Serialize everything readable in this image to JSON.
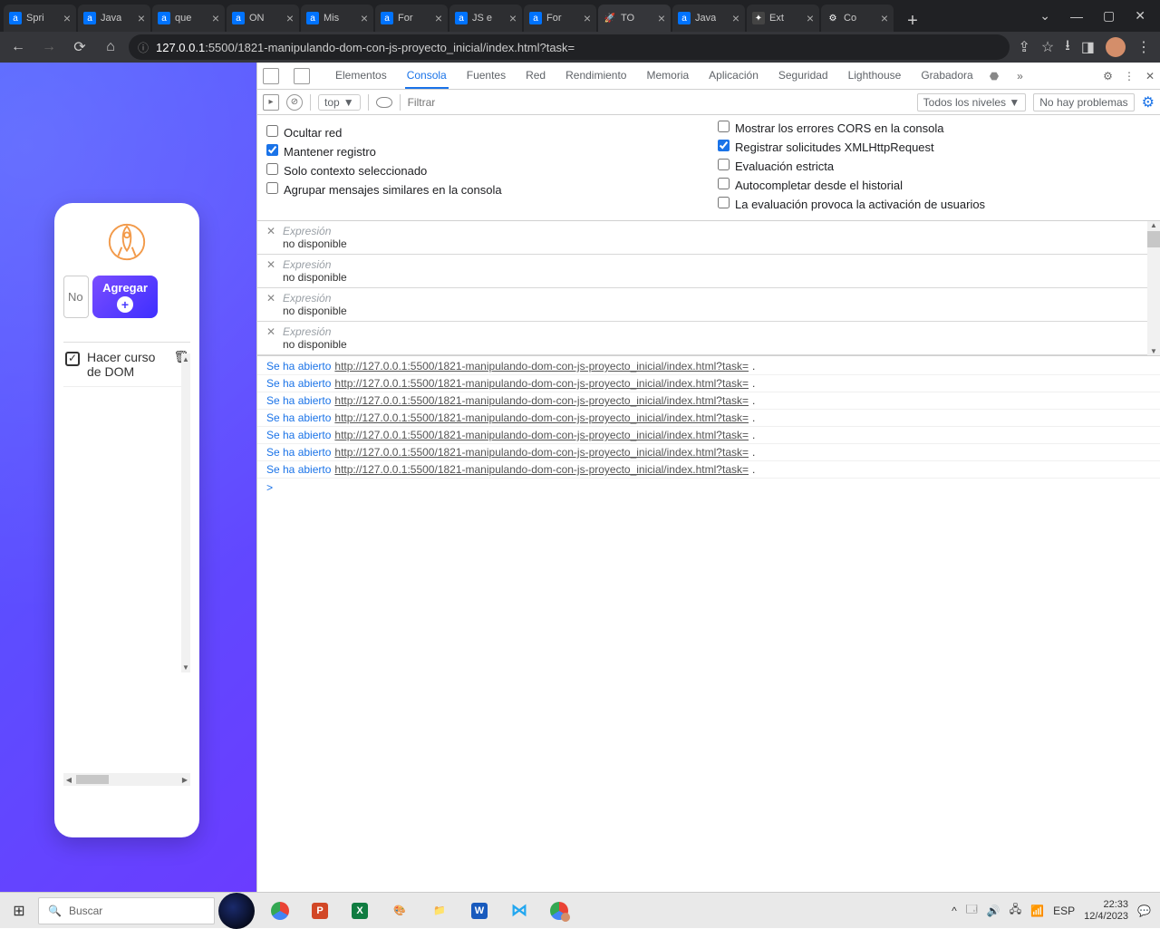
{
  "tabs": [
    {
      "fav": "a",
      "title": "Spri",
      "cls": "fav-a"
    },
    {
      "fav": "a",
      "title": "Java",
      "cls": "fav-a"
    },
    {
      "fav": "a",
      "title": "que",
      "cls": "fav-a"
    },
    {
      "fav": "a",
      "title": "ON",
      "cls": "fav-a"
    },
    {
      "fav": "a",
      "title": "Mis",
      "cls": "fav-a"
    },
    {
      "fav": "a",
      "title": "For",
      "cls": "fav-a"
    },
    {
      "fav": "a",
      "title": "JS e",
      "cls": "fav-a"
    },
    {
      "fav": "a",
      "title": "For",
      "cls": "fav-a"
    },
    {
      "fav": "🚀",
      "title": "TO",
      "cls": "fav-rocket",
      "active": true
    },
    {
      "fav": "a",
      "title": "Java",
      "cls": "fav-a"
    },
    {
      "fav": "✦",
      "title": "Ext",
      "cls": "fav-ext"
    },
    {
      "fav": "⚙",
      "title": "Co",
      "cls": "fav-gear"
    }
  ],
  "url": {
    "host": "127.0.0.1",
    "rest": ":5500/1821-manipulando-dom-con-js-proyecto_inicial/index.html?task="
  },
  "app": {
    "input_placeholder": "No",
    "add_label": "Agregar",
    "task_text": "Hacer curso de DOM"
  },
  "devtools": {
    "tabs": [
      "Elementos",
      "Consola",
      "Fuentes",
      "Red",
      "Rendimiento",
      "Memoria",
      "Aplicación",
      "Seguridad",
      "Lighthouse",
      "Grabadora"
    ],
    "active_tab": "Consola",
    "top_label": "top",
    "filter_placeholder": "Filtrar",
    "levels_label": "Todos los niveles",
    "noproblems_label": "No hay problemas",
    "checks_left": [
      "Ocultar red",
      "Mantener registro",
      "Solo contexto seleccionado",
      "Agrupar mensajes similares en la consola",
      "Mostrar los errores CORS en la consola"
    ],
    "checks_right": [
      "Registrar solicitudes XMLHttpRequest",
      "Evaluación estricta",
      "Autocompletar desde el historial",
      "La evaluación provoca la activación de usuarios"
    ],
    "checked": [
      "Mantener registro",
      "Registrar solicitudes XMLHttpRequest"
    ],
    "expr_label": "Expresión",
    "expr_value": "no disponible",
    "expr_count": 4,
    "log_prefix": "Se ha abierto",
    "log_url": "http://127.0.0.1:5500/1821-manipulando-dom-con-js-proyecto_inicial/index.html?task=",
    "log_count": 7,
    "prompt": ">"
  },
  "taskbar": {
    "search_placeholder": "Buscar",
    "lang": "ESP",
    "time": "22:33",
    "date": "12/4/2023"
  }
}
